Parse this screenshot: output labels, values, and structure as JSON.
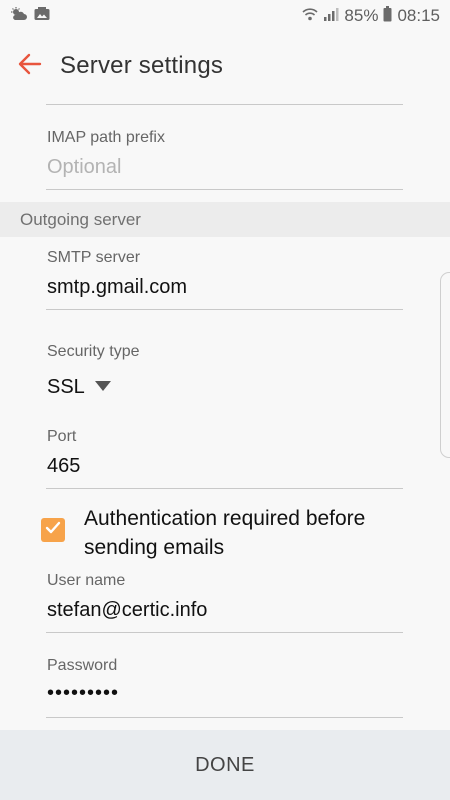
{
  "status_bar": {
    "battery_percent": "85%",
    "time": "08:15",
    "icons": [
      "weather-icon",
      "gallery-notification-icon",
      "wifi-icon",
      "signal-icon",
      "battery-icon"
    ]
  },
  "app_bar": {
    "title": "Server settings",
    "back_icon": "arrow-left-icon",
    "accent_color": "#e8553d"
  },
  "imap": {
    "path_prefix_label": "IMAP path prefix",
    "path_prefix_placeholder": "Optional"
  },
  "outgoing": {
    "section_title": "Outgoing server",
    "smtp_label": "SMTP server",
    "smtp_value": "smtp.gmail.com",
    "security_label": "Security type",
    "security_value": "SSL",
    "port_label": "Port",
    "port_value": "465",
    "auth_checkbox_label": "Authentication required before sending emails",
    "auth_checked": true,
    "checkbox_color": "#f7a34a",
    "username_label": "User name",
    "username_value": "stefan@certic.info",
    "password_label": "Password",
    "password_value": "•••••••••"
  },
  "footer": {
    "done_label": "DONE"
  }
}
